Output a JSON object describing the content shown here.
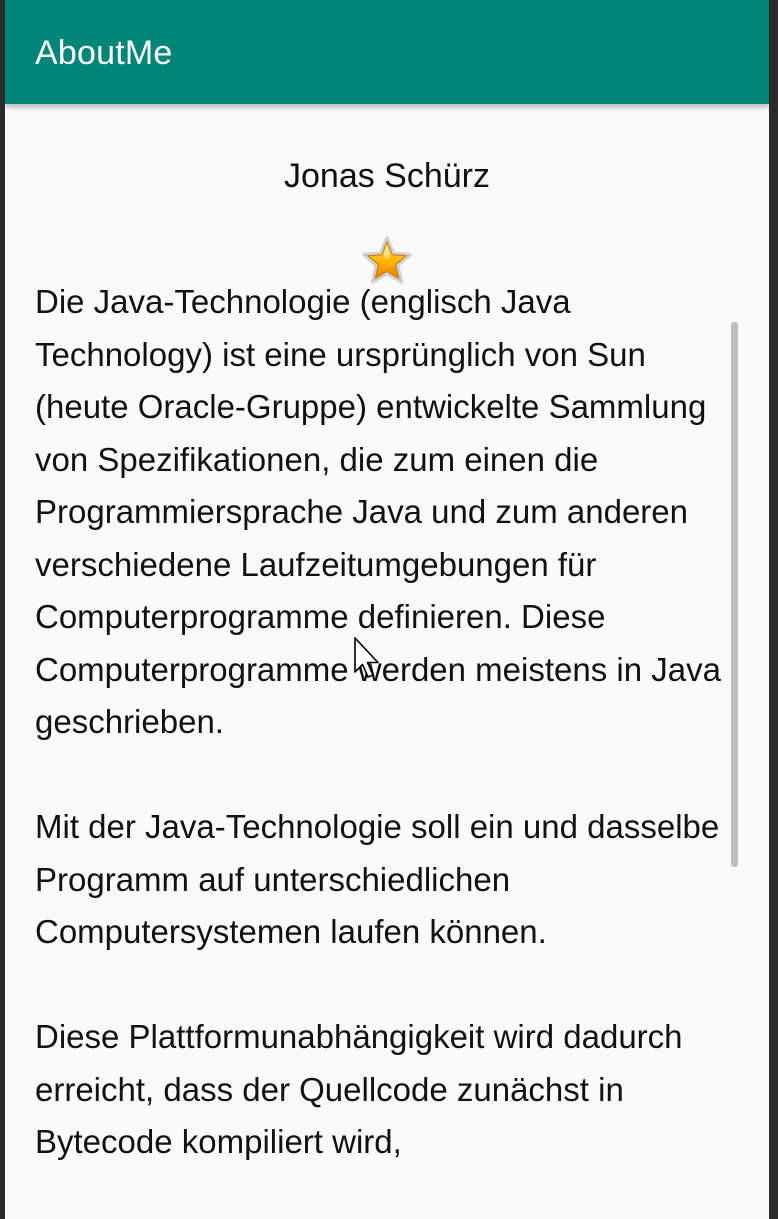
{
  "app_bar": {
    "title": "AboutMe",
    "color": "#008577"
  },
  "profile": {
    "name": "Jonas Schürz",
    "icon": "star-icon"
  },
  "bio": {
    "paragraphs": [
      "Die Java-Technologie (englisch Java Technology) ist eine ursprünglich von Sun (heute Oracle-Gruppe) entwickelte Sammlung von Spezifikationen, die zum einen die Programmiersprache Java und zum anderen verschiedene Laufzeitumgebungen für Computerprogramme definieren. Diese Computerprogramme werden meistens in Java geschrieben.",
      "Mit der Java-Technologie soll ein und dasselbe Programm auf unterschiedlichen Computersystemen laufen können.",
      "Diese Plattformunabhängigkeit wird dadurch erreicht, dass der Quellcode zunächst in Bytecode kompiliert wird,"
    ]
  }
}
